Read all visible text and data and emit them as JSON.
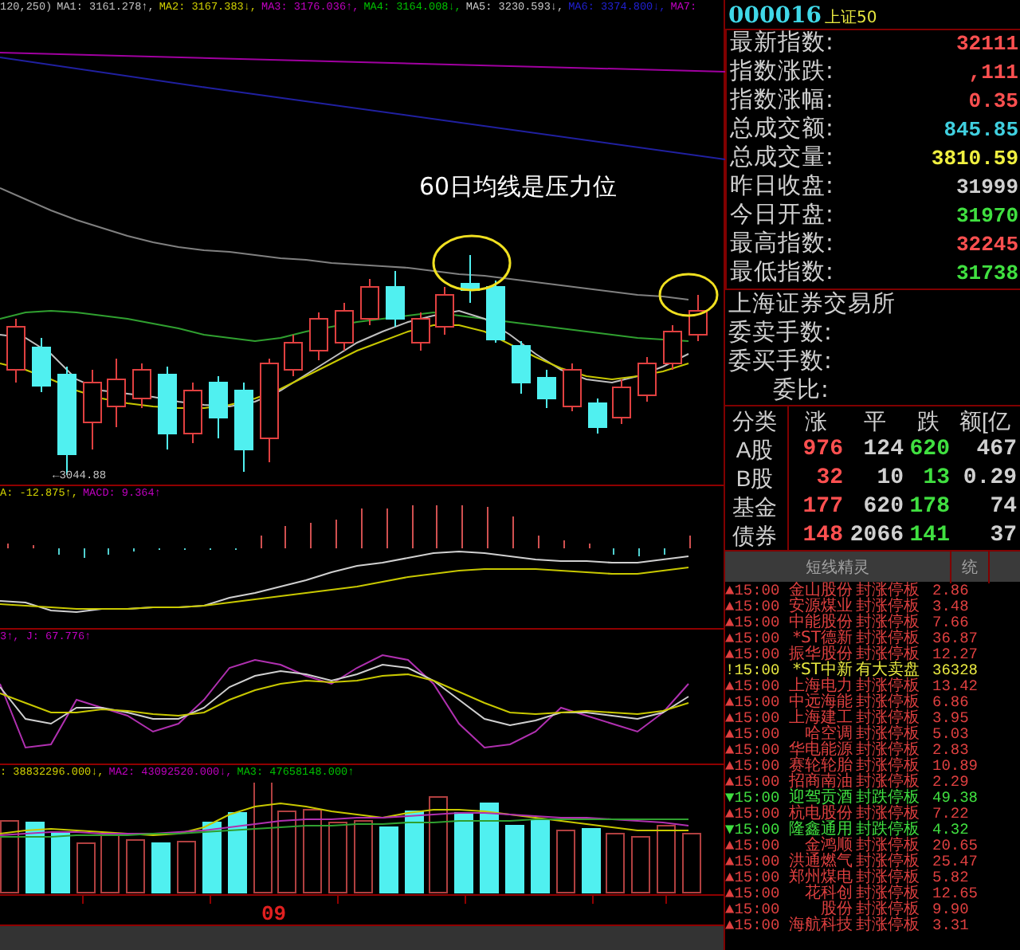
{
  "chart": {
    "ma_legend": [
      {
        "text": "120,250)",
        "color": "#c0c0c0"
      },
      {
        "text": "MA1: 3161.278↑,",
        "color": "#c0c0c0"
      },
      {
        "text": "MA2: 3167.383↓,",
        "color": "#d0d000"
      },
      {
        "text": "MA3: 3176.036↑,",
        "color": "#c000c0"
      },
      {
        "text": "MA4: 3164.008↓,",
        "color": "#00c000"
      },
      {
        "text": "MA5: 3230.593↓,",
        "color": "#c8c8c8"
      },
      {
        "text": "MA6: 3374.800↓,",
        "color": "#2020d0"
      },
      {
        "text": "MA7:",
        "color": "#c000c1"
      }
    ],
    "annotation": "60日均线是压力位",
    "low_label": "←3044.88",
    "macd_legend": [
      {
        "text": "A: -12.875↑,",
        "color": "#d0d000"
      },
      {
        "text": "MACD: 9.364↑",
        "color": "#c000c0"
      }
    ],
    "kdj_legend": [
      {
        "text": "3↑, J: 67.776↑",
        "color": "#c000c0"
      }
    ],
    "volume_legend": [
      {
        "text": ": 38832296.000↓,",
        "color": "#d0d000"
      },
      {
        "text": "MA2: 43092520.000↓,",
        "color": "#c000c0"
      },
      {
        "text": "MA3: 47658148.000↑",
        "color": "#00c000"
      }
    ],
    "axis_label": "09"
  },
  "quote": {
    "code": "000016",
    "name": "上证50",
    "fields": [
      {
        "label": "最新指数:",
        "value": "32111",
        "color": "#ff5050"
      },
      {
        "label": "指数涨跌:",
        "value": ",111",
        "color": "#ff5050"
      },
      {
        "label": "指数涨幅:",
        "value": "0.35",
        "color": "#ff5050"
      },
      {
        "label": "总成交额:",
        "value": "845.85",
        "color": "#40d0e0"
      },
      {
        "label": "总成交量:",
        "value": "3810.59",
        "color": "#f0f040"
      },
      {
        "label": "昨日收盘:",
        "value": "31999",
        "color": "#d0d0d0"
      },
      {
        "label": "今日开盘:",
        "value": "31970",
        "color": "#40e040"
      },
      {
        "label": "最高指数:",
        "value": "32245",
        "color": "#ff5050"
      },
      {
        "label": "最低指数:",
        "value": "31738",
        "color": "#40e040"
      }
    ],
    "exchange": "上海证券交易所",
    "order_fields": [
      "委卖手数:",
      "委买手数:",
      "委比:"
    ]
  },
  "breadth": {
    "columns": [
      "分类",
      "涨",
      "平",
      "跌",
      "额[亿"
    ],
    "rows": [
      {
        "cells": [
          "A股",
          "976",
          "124",
          "620",
          "467"
        ]
      },
      {
        "cells": [
          "B股",
          "32",
          "10",
          "13",
          "0.29"
        ]
      },
      {
        "cells": [
          "基金",
          "177",
          "620",
          "178",
          "74"
        ]
      },
      {
        "cells": [
          "债券",
          "148",
          "2066",
          "141",
          "37"
        ]
      }
    ]
  },
  "tabs": [
    {
      "label": "短线精灵"
    },
    {
      "label": "统"
    }
  ],
  "alerts": [
    {
      "kind": "up",
      "marker": "▲",
      "time": "15:00",
      "name": "金山股份",
      "event": "封涨停板",
      "value": "2.86"
    },
    {
      "kind": "up",
      "marker": "▲",
      "time": "15:00",
      "name": "安源煤业",
      "event": "封涨停板",
      "value": "3.48"
    },
    {
      "kind": "up",
      "marker": "▲",
      "time": "15:00",
      "name": "中能股份",
      "event": "封涨停板",
      "value": "7.66"
    },
    {
      "kind": "up",
      "marker": "▲",
      "time": "15:00",
      "name": "*ST德新",
      "event": "封涨停板",
      "value": "36.87"
    },
    {
      "kind": "up",
      "marker": "▲",
      "time": "15:00",
      "name": "振华股份",
      "event": "封涨停板",
      "value": "12.27"
    },
    {
      "kind": "trade",
      "marker": "!",
      "time": "15:00",
      "name": "*ST中新",
      "event": "有大卖盘",
      "value": "36328"
    },
    {
      "kind": "up",
      "marker": "▲",
      "time": "15:00",
      "name": "上海电力",
      "event": "封涨停板",
      "value": "13.42"
    },
    {
      "kind": "up",
      "marker": "▲",
      "time": "15:00",
      "name": "中远海能",
      "event": "封涨停板",
      "value": "6.86"
    },
    {
      "kind": "up",
      "marker": "▲",
      "time": "15:00",
      "name": "上海建工",
      "event": "封涨停板",
      "value": "3.95"
    },
    {
      "kind": "up",
      "marker": "▲",
      "time": "15:00",
      "name": "哈空调",
      "event": "封涨停板",
      "value": "5.03"
    },
    {
      "kind": "up",
      "marker": "▲",
      "time": "15:00",
      "name": "华电能源",
      "event": "封涨停板",
      "value": "2.83"
    },
    {
      "kind": "up",
      "marker": "▲",
      "time": "15:00",
      "name": "赛轮轮胎",
      "event": "封涨停板",
      "value": "10.89"
    },
    {
      "kind": "up",
      "marker": "▲",
      "time": "15:00",
      "name": "招商南油",
      "event": "封涨停板",
      "value": "2.29"
    },
    {
      "kind": "down",
      "marker": "▼",
      "time": "15:00",
      "name": "迎驾贡酒",
      "event": "封跌停板",
      "value": "49.38"
    },
    {
      "kind": "up",
      "marker": "▲",
      "time": "15:00",
      "name": "杭电股份",
      "event": "封涨停板",
      "value": "7.22"
    },
    {
      "kind": "down",
      "marker": "▼",
      "time": "15:00",
      "name": "隆鑫通用",
      "event": "封跌停板",
      "value": "4.32"
    },
    {
      "kind": "up",
      "marker": "▲",
      "time": "15:00",
      "name": "金鸿顺",
      "event": "封涨停板",
      "value": "20.65"
    },
    {
      "kind": "up",
      "marker": "▲",
      "time": "15:00",
      "name": "洪通燃气",
      "event": "封涨停板",
      "value": "25.47"
    },
    {
      "kind": "up",
      "marker": "▲",
      "time": "15:00",
      "name": "郑州煤电",
      "event": "封涨停板",
      "value": "5.82"
    },
    {
      "kind": "up",
      "marker": "▲",
      "time": "15:00",
      "name": "花科创",
      "event": "封涨停板",
      "value": "12.65"
    },
    {
      "kind": "up",
      "marker": "▲",
      "time": "15:00",
      "name": "股份",
      "event": "封涨停板",
      "value": "9.90"
    },
    {
      "kind": "up",
      "marker": "▲",
      "time": "15:00",
      "name": "海航科技",
      "event": "封涨停板",
      "value": "3.31"
    }
  ]
}
